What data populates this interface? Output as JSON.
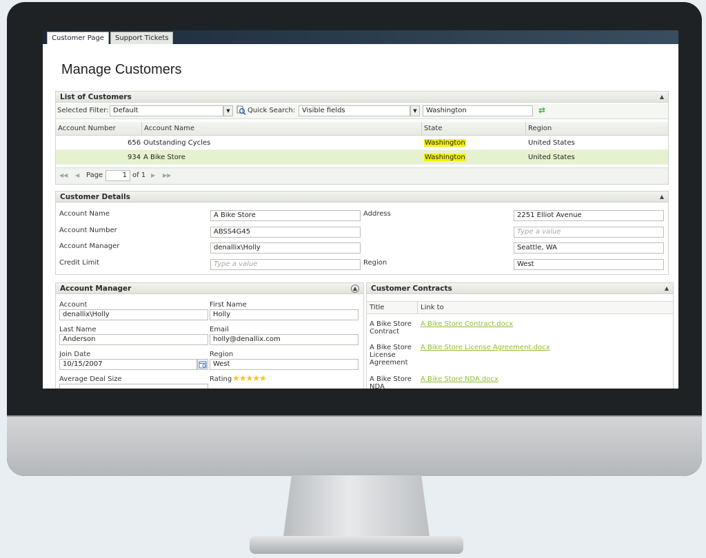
{
  "tabs": [
    {
      "label": "Customer Page"
    },
    {
      "label": "Support Tickets"
    }
  ],
  "page_title": "Manage Customers",
  "list": {
    "header": "List of Customers",
    "filter_label": "Selected Filter:",
    "filter_value": "Default",
    "quick_search_label": "Quick Search:",
    "quick_search_value": "Visible fields",
    "search_text": "Washington",
    "columns": [
      "Account Number",
      "Account Name",
      "State",
      "Region"
    ],
    "rows": [
      {
        "number": "656",
        "name": "Outstanding Cycles",
        "state": "Washington",
        "region": "United States"
      },
      {
        "number": "934",
        "name": "A Bike Store",
        "state": "Washington",
        "region": "United States"
      }
    ],
    "pager": {
      "page_label": "Page",
      "page_value": "1",
      "of_label": "of 1"
    }
  },
  "details": {
    "header": "Customer Details",
    "account_name_label": "Account Name",
    "account_name": "A Bike Store",
    "account_number_label": "Account Number",
    "account_number": "ABSS4G45",
    "account_manager_label": "Account Manager",
    "account_manager": "denallix\\Holly",
    "credit_limit_label": "Credit Limit",
    "credit_limit_placeholder": "Type a value",
    "address_label": "Address",
    "address_line1": "2251 Elliot Avenue",
    "address_line2_placeholder": "Type a value",
    "address_city": "Seattle, WA",
    "region_label": "Region",
    "region": "West"
  },
  "manager": {
    "header": "Account Manager",
    "account_label": "Account",
    "account": "denallix\\Holly",
    "first_name_label": "First Name",
    "first_name": "Holly",
    "last_name_label": "Last Name",
    "last_name": "Anderson",
    "email_label": "Email",
    "email": "holly@denallix.com",
    "join_date_label": "Join Date",
    "join_date": "10/15/2007",
    "region_label": "Region",
    "region": "West",
    "deal_size_label": "Average Deal Size",
    "rating_label": "Rating",
    "rating": 5
  },
  "contracts": {
    "header": "Customer Contracts",
    "col_title": "Title",
    "col_link": "Link to",
    "items": [
      {
        "title_lines": [
          "A Bike Store",
          "Contract"
        ],
        "link": "A Bike Store Contract.docx"
      },
      {
        "title_lines": [
          "A Bike Store",
          "License",
          "Agreement"
        ],
        "link": "A Bike Store License Agreement.docx"
      },
      {
        "title_lines": [
          "A Bike Store",
          "NDA"
        ],
        "link": "A Bike Store NDA.docx"
      }
    ]
  }
}
